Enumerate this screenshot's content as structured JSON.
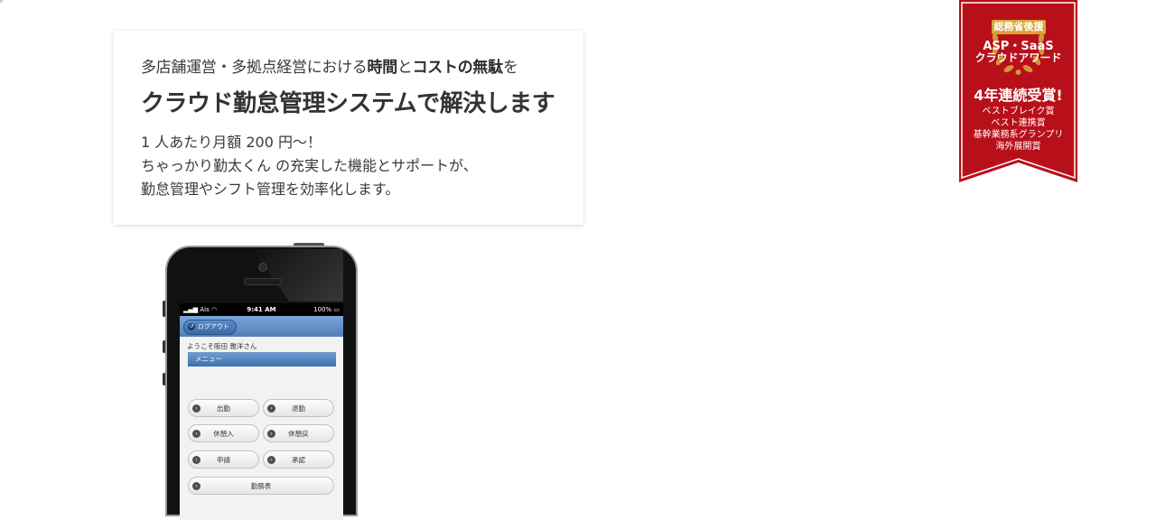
{
  "intro": {
    "lead_part1": "多店舗運営・多拠点経営における",
    "lead_bold1": "時間",
    "lead_part2": "と",
    "lead_bold2": "コストの無駄",
    "lead_part3": "を",
    "headline": "クラウド勤怠管理システムで解決します",
    "desc_line1": "1 人あたり月額 200 円〜！",
    "desc_line2": "ちゃっかり勤太くん の充実した機能とサポートが、",
    "desc_line3": "勤怠管理やシフト管理を効率化します。"
  },
  "award": {
    "badge": "総務省後援",
    "title1": "ASP・SaaS",
    "title2": "クラウドアワード",
    "headline": "4年連続受賞!",
    "prizes": [
      "ベストブレイク賞",
      "ベスト連携賞",
      "基幹業務系グランプリ",
      "海外展開賞"
    ],
    "colors": {
      "ribbon": "#b8101a",
      "border": "#ffffff",
      "laurel": "#d9a43a"
    }
  },
  "phone": {
    "status": {
      "carrier": "Ais",
      "time": "9:41 AM",
      "battery": "100%"
    },
    "logout_label": "ログアウト",
    "welcome": "ようこそ阪田 雅洋さん",
    "menu_title": "メニュー",
    "buttons": [
      "出勤",
      "退勤",
      "休憩入",
      "休憩戻",
      "申請",
      "承認",
      "勤務表"
    ],
    "colors": {
      "header": "#4f7fb8"
    }
  }
}
